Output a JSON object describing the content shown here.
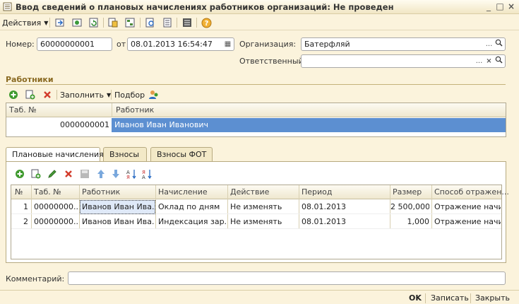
{
  "window": {
    "title": "Ввод сведений о плановых начислениях работников организаций: Не проведен",
    "controls": [
      "_",
      "□",
      "×"
    ]
  },
  "toolbar": {
    "actions_label": "Действия"
  },
  "form": {
    "number_label": "Номер:",
    "number_value": "60000000001",
    "date_label": "от",
    "date_value": "08.01.2013 16:54:47",
    "org_label": "Организация:",
    "org_value": "Батерфляй",
    "responsible_label": "Ответственный:",
    "responsible_value": "",
    "fbtn_ellipsis": "...",
    "fbtn_clear": "×"
  },
  "employees": {
    "section_title": "Работники",
    "fill_label": "Заполнить",
    "pick_label": "Подбор",
    "columns": [
      "Таб. №",
      "Работник"
    ],
    "rows": [
      {
        "tab": "0000000001",
        "name": "Иванов Иван Иванович"
      }
    ]
  },
  "tabs": {
    "items": [
      "Плановые начисления",
      "Взносы",
      "Взносы ФОТ"
    ]
  },
  "accruals": {
    "columns": [
      "№",
      "Таб. №",
      "Работник",
      "Начисление",
      "Действие",
      "Период",
      "Размер",
      "Способ отражен..."
    ],
    "rows": [
      {
        "n": "1",
        "tab": "00000000...",
        "employee": "Иванов Иван Ива...",
        "accrual": "Оклад по дням",
        "action": "Не изменять",
        "period": "08.01.2013",
        "amount": "2 500,000",
        "method": "Отражение начи..."
      },
      {
        "n": "2",
        "tab": "00000000...",
        "employee": "Иванов Иван Ива...",
        "accrual": "Индексация зар...",
        "action": "Не изменять",
        "period": "08.01.2013",
        "amount": "1,000",
        "method": "Отражение начи..."
      }
    ]
  },
  "comment": {
    "label": "Комментарий:",
    "value": ""
  },
  "footer": {
    "ok": "OK",
    "save": "Записать",
    "close": "Закрыть"
  },
  "colors": {
    "background": "#fbf3dc",
    "selection": "#5c8fd1",
    "section_title": "#8a6a22"
  }
}
